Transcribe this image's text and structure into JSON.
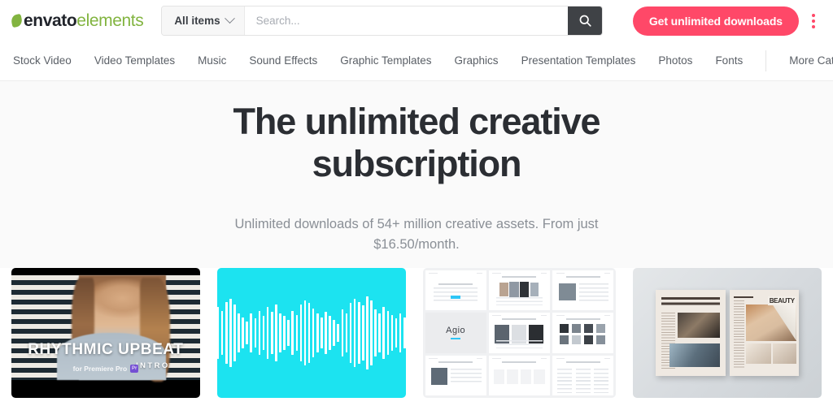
{
  "header": {
    "logo": {
      "brand": "envato",
      "product": "elements",
      "leaf_icon": "leaf-icon"
    },
    "search": {
      "category_label": "All items",
      "chevron_icon": "chevron-down-icon",
      "placeholder": "Search...",
      "value": "",
      "submit_icon": "search-icon"
    },
    "cta_label": "Get unlimited downloads",
    "overflow_icon": "kebab-menu-icon",
    "accent_color": "#ff4868",
    "brand_green": "#82b440"
  },
  "nav": {
    "items": [
      "Stock Video",
      "Video Templates",
      "Music",
      "Sound Effects",
      "Graphic Templates",
      "Graphics",
      "Presentation Templates",
      "Photos",
      "Fonts"
    ],
    "more_label": "More Categories"
  },
  "hero": {
    "headline_line1": "The unlimited creative",
    "headline_line2": "subscription",
    "subhead": "Unlimited downloads of 54+ million creative assets. From just $16.50/month.",
    "background_color": "#fafafa"
  },
  "cards": [
    {
      "type": "video-template",
      "title": "RHYTHMIC UPBEAT",
      "subtitle": "INTRO",
      "footer": "for Premiere Pro",
      "app_badge": "Pr"
    },
    {
      "type": "audio-waveform",
      "background_color": "#1ce3f0",
      "wave_heights": [
        6,
        10,
        22,
        16,
        40,
        34,
        48,
        52,
        44,
        30,
        24,
        18,
        30,
        22,
        34,
        26,
        40,
        32,
        44,
        30,
        26,
        20,
        34,
        28,
        44,
        50,
        46,
        38,
        30,
        24,
        32,
        26,
        20,
        14,
        36,
        30,
        46,
        52,
        48,
        42,
        56,
        50,
        36,
        30,
        40,
        34,
        28,
        22,
        30,
        24,
        18,
        12,
        8,
        5
      ]
    },
    {
      "type": "presentation-template",
      "brand": "Agio",
      "slide_count": 9
    },
    {
      "type": "print-mockup",
      "headline_left": "Nam Blandit Quam Ante, In Imperdiet Velit Fermentum Ut",
      "headline_right": "Your Title Here",
      "masthead": "BEAUTY"
    }
  ]
}
